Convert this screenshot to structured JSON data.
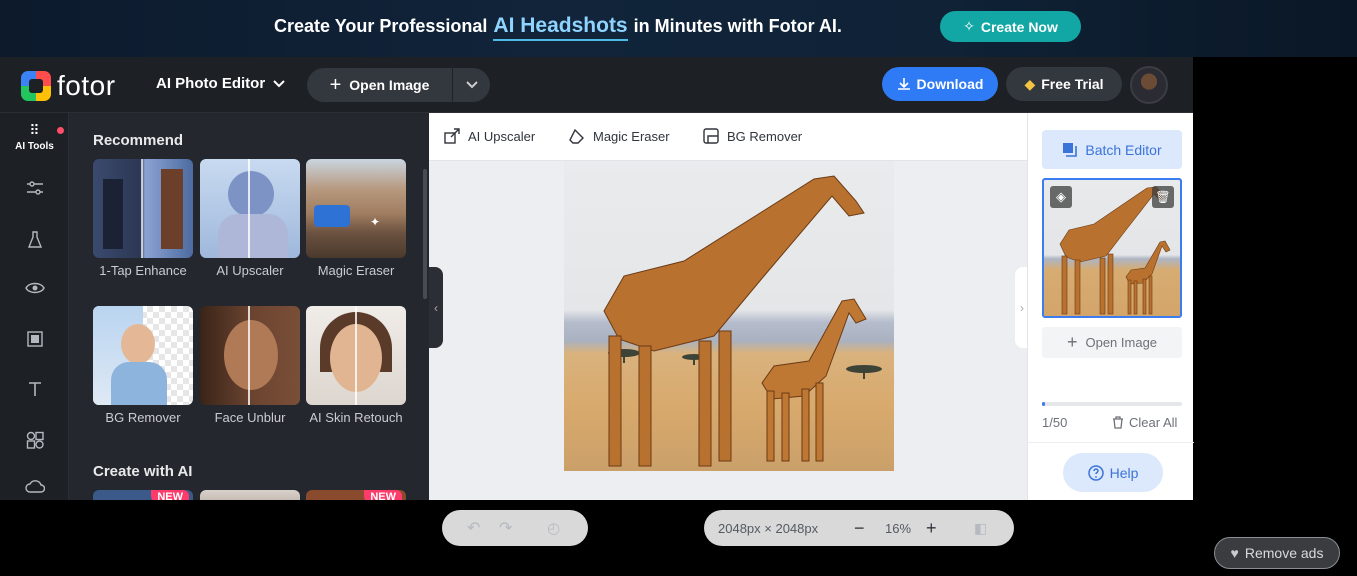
{
  "banner": {
    "text_before": "Create Your Professional",
    "highlight": "AI Headshots",
    "text_after": "in Minutes with Fotor AI.",
    "cta": "Create Now"
  },
  "header": {
    "logo": "fotor",
    "editor_select": "AI Photo Editor",
    "open_image": "Open Image",
    "download": "Download",
    "free_trial": "Free Trial"
  },
  "rail": {
    "active_label": "AI Tools",
    "items": [
      "adjust-icon",
      "beauty-icon",
      "eye-icon",
      "frame-icon",
      "text-icon",
      "elements-icon",
      "cloud-icon"
    ]
  },
  "panel": {
    "recommend_title": "Recommend",
    "tools": [
      {
        "label": "1-Tap Enhance"
      },
      {
        "label": "AI Upscaler"
      },
      {
        "label": "Magic Eraser"
      },
      {
        "label": "BG Remover"
      },
      {
        "label": "Face Unblur"
      },
      {
        "label": "AI Skin Retouch"
      }
    ],
    "create_title": "Create with AI",
    "new_badge": "NEW"
  },
  "toolbar": {
    "upscaler": "AI Upscaler",
    "eraser": "Magic Eraser",
    "bg_remover": "BG Remover"
  },
  "canvas": {
    "dimensions": "2048px × 2048px",
    "zoom": "16%"
  },
  "right_panel": {
    "batch_editor": "Batch Editor",
    "open_image": "Open Image",
    "count": "1/50",
    "progress": 0.02,
    "clear_all": "Clear All",
    "help": "Help"
  },
  "remove_ads": "Remove ads",
  "colors": {
    "accent": "#2f7bf5",
    "banner_cta": "#12a7a4",
    "new_badge": "#ff3b6b"
  }
}
